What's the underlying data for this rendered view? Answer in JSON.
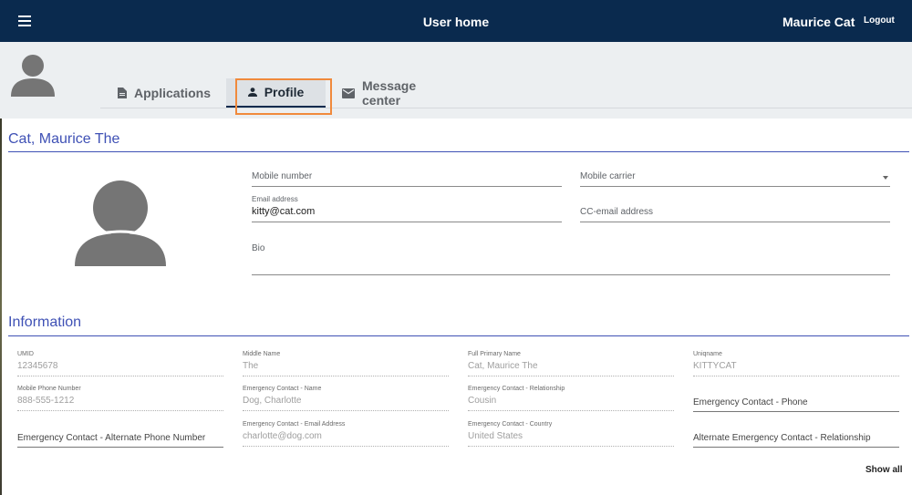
{
  "topbar": {
    "menu_icon": "hamburger-menu-icon",
    "title": "User home",
    "username": "Maurice Cat",
    "logout_label": "Logout",
    "bg_color": "#0a2a4e"
  },
  "tabs": [
    {
      "label": "Applications",
      "icon": "document-icon",
      "active": false
    },
    {
      "label": "Profile",
      "icon": "person-icon",
      "active": true
    },
    {
      "label": "Message center",
      "icon": "envelope-icon",
      "active": false
    }
  ],
  "profile": {
    "name_heading": "Cat, Maurice The",
    "fields": {
      "mobile_number": {
        "placeholder": "Mobile number",
        "value": ""
      },
      "mobile_carrier": {
        "placeholder": "Mobile carrier",
        "value": ""
      },
      "email": {
        "label": "Email address",
        "value": "kitty@cat.com"
      },
      "cc_email": {
        "placeholder": "CC-email address",
        "value": ""
      },
      "bio": {
        "placeholder": "Bio",
        "value": ""
      }
    }
  },
  "information": {
    "heading": "Information",
    "items": [
      {
        "label": "UMID",
        "value": "12345678"
      },
      {
        "label": "Middle Name",
        "value": "The"
      },
      {
        "label": "Full Primary Name",
        "value": "Cat, Maurice The"
      },
      {
        "label": "Uniqname",
        "value": "KITTYCAT"
      },
      {
        "label": "Mobile Phone Number",
        "value": "888-555-1212"
      },
      {
        "label": "Emergency Contact - Name",
        "value": "Dog, Charlotte"
      },
      {
        "label": "Emergency Contact - Relationship",
        "value": "Cousin"
      },
      {
        "label": "Emergency Contact - Phone",
        "value": ""
      },
      {
        "label": "Emergency Contact - Alternate Phone Number",
        "value": ""
      },
      {
        "label": "Emergency Contact - Email Address",
        "value": "charlotte@dog.com"
      },
      {
        "label": "Emergency Contact - Country",
        "value": "United States"
      },
      {
        "label": "Alternate Emergency Contact - Relationship",
        "value": ""
      }
    ],
    "show_all_label": "Show all"
  },
  "colors": {
    "accent": "#3f51b5",
    "highlight": "#f08a3c"
  }
}
